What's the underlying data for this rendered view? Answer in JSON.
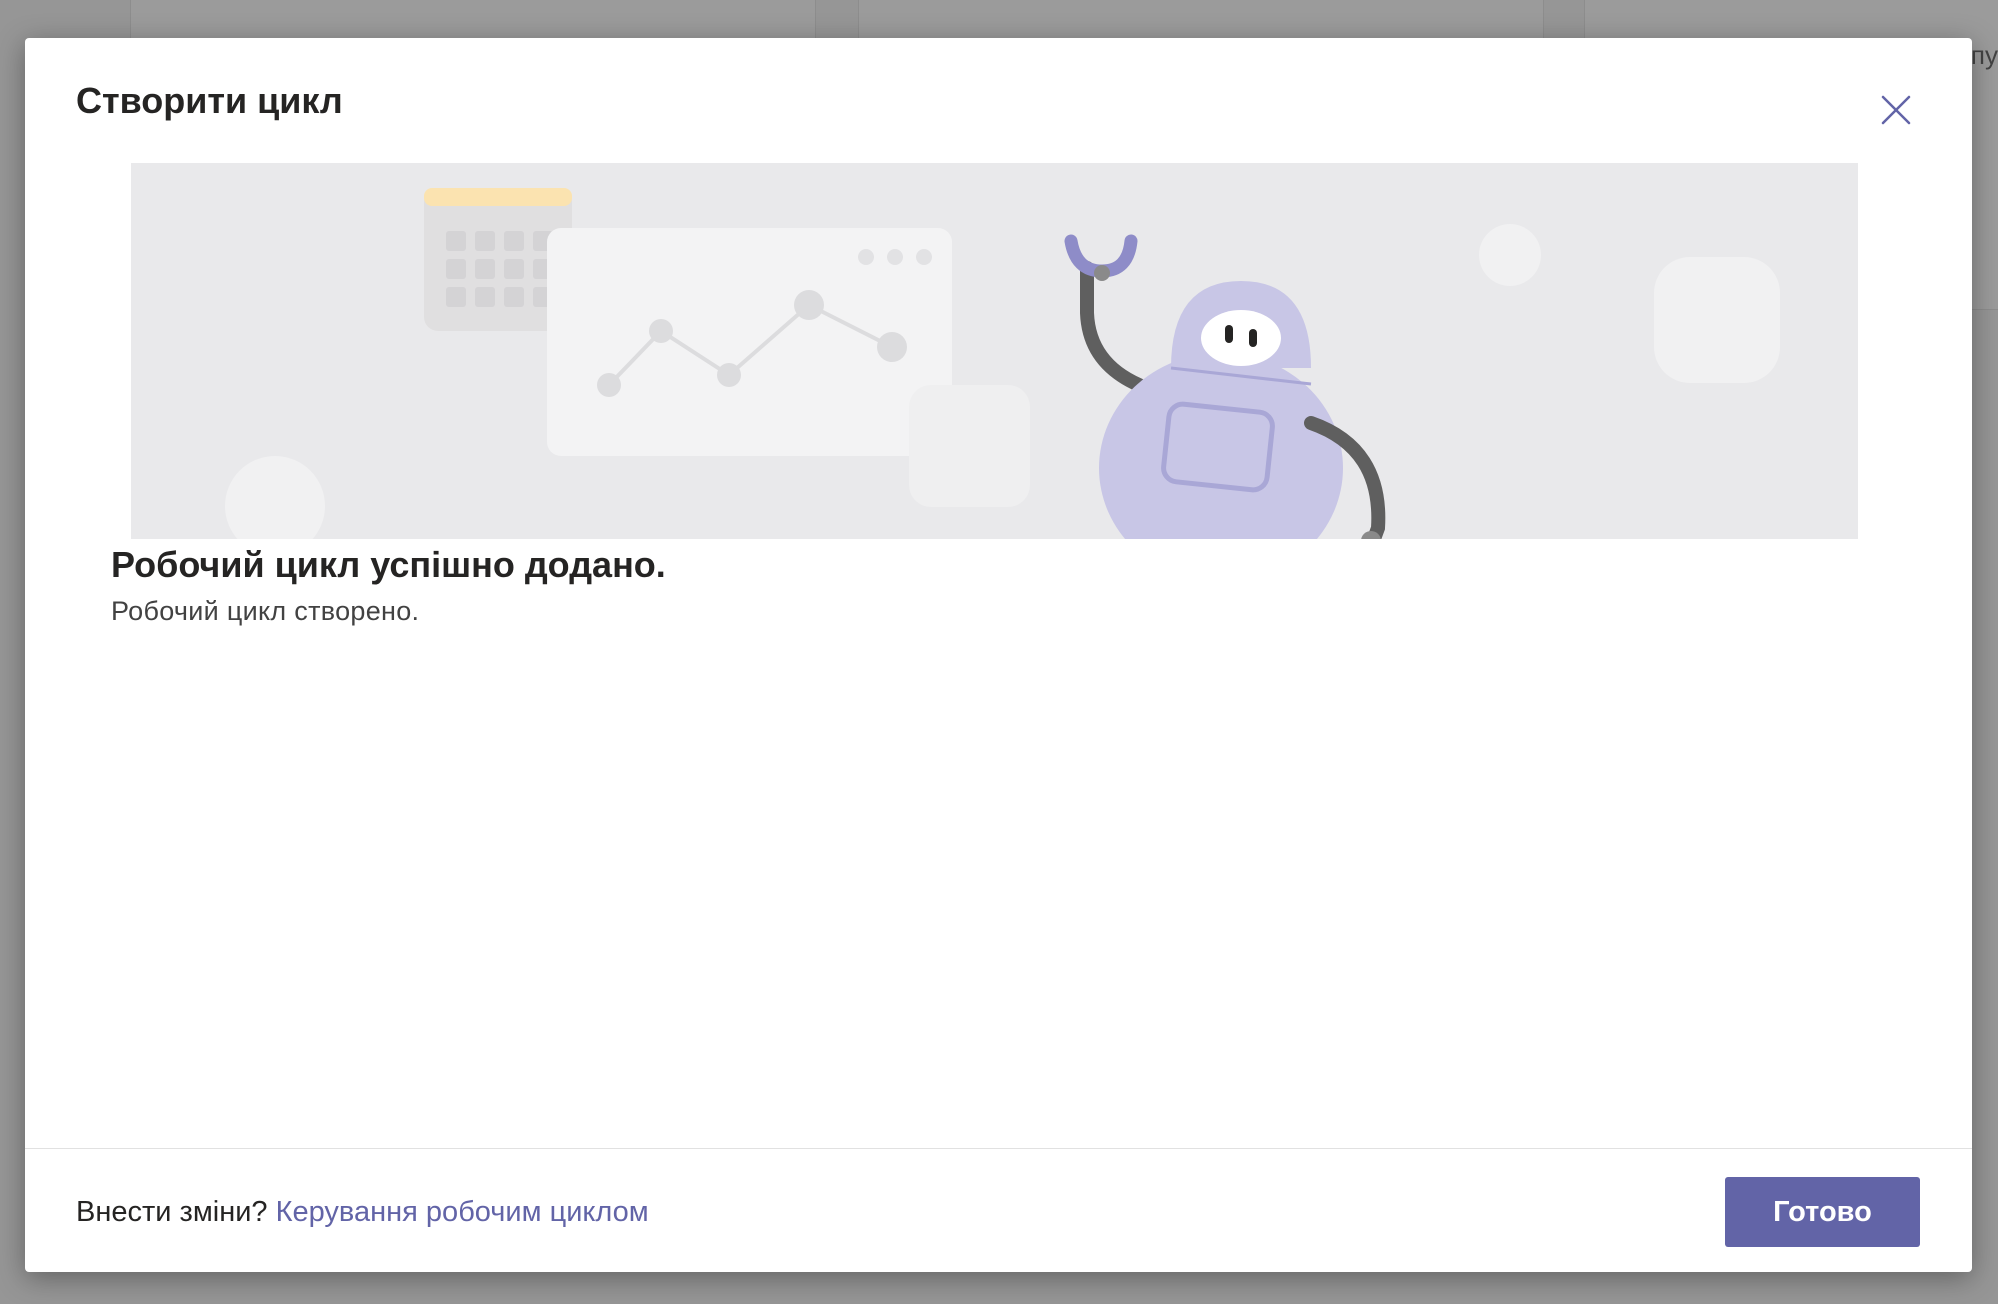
{
  "background": {
    "partial_text": "пу"
  },
  "dialog": {
    "title": "Створити цикл",
    "close_label": "×",
    "success_title": "Робочий цикл успішно додано.",
    "success_subtitle": "Робочий цикл створено.",
    "footer": {
      "prompt": "Внести зміни?",
      "link": "Керування робочим циклом",
      "done_button": "Готово"
    }
  },
  "colors": {
    "accent": "#6264a7",
    "hero_background": "#e9e9eb",
    "robot_body": "#c8c6e6",
    "robot_arm": "#5f5f5f",
    "calendar_top": "#fbe3b0"
  },
  "illustration": {
    "icons": [
      "calendar-icon",
      "line-chart-card",
      "robot-illustration"
    ]
  }
}
